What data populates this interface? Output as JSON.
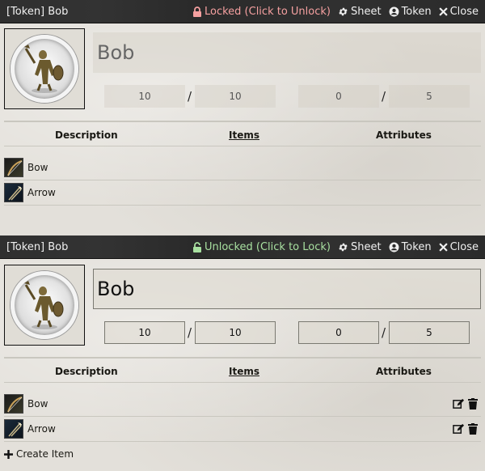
{
  "sheets": [
    {
      "title": "[Token] Bob",
      "lock_label": "Locked (Click to Unlock)",
      "lock_state": "locked",
      "sheet_label": "Sheet",
      "token_label": "Token",
      "close_label": "Close",
      "name": "Bob",
      "resource1": {
        "value": "10",
        "max": "10"
      },
      "resource2": {
        "value": "0",
        "max": "5"
      },
      "separator": "/",
      "headers": {
        "description": "Description",
        "items": "Items",
        "attributes": "Attributes"
      },
      "items": [
        {
          "name": "Bow",
          "icon": "bow-icon"
        },
        {
          "name": "Arrow",
          "icon": "arrow-icon"
        }
      ]
    },
    {
      "title": "[Token] Bob",
      "lock_label": "Unlocked (Click to Lock)",
      "lock_state": "unlocked",
      "sheet_label": "Sheet",
      "token_label": "Token",
      "close_label": "Close",
      "name": "Bob",
      "resource1": {
        "value": "10",
        "max": "10"
      },
      "resource2": {
        "value": "0",
        "max": "5"
      },
      "separator": "/",
      "headers": {
        "description": "Description",
        "items": "Items",
        "attributes": "Attributes"
      },
      "items": [
        {
          "name": "Bow",
          "icon": "bow-icon"
        },
        {
          "name": "Arrow",
          "icon": "arrow-icon"
        }
      ],
      "create_item_label": "Create Item"
    }
  ],
  "colors": {
    "locked": "#f5a0a0",
    "unlocked": "#a8e0a0",
    "header_bg": "#2b2b2b"
  }
}
